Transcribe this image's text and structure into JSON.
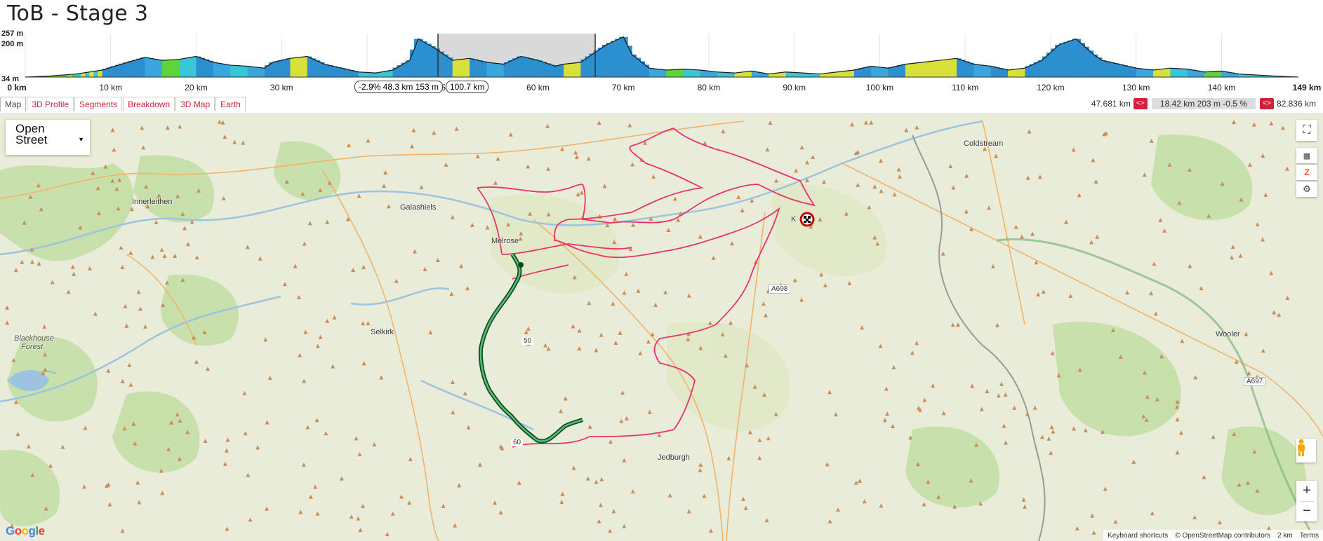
{
  "title": "ToB - Stage 3",
  "profile": {
    "y_labels": [
      "257 m",
      "200 m",
      "34 m"
    ],
    "x_labels": [
      "0 km",
      "10 km",
      "20 km",
      "30 km",
      "40 km",
      "50 km",
      "60 km",
      "70 km",
      "80 km",
      "90 km",
      "100 km",
      "110 km",
      "120 km",
      "130 km",
      "140 km",
      "149 km"
    ],
    "selection_info": "-2.9% 48.3 km 153 m",
    "selection_end": "100.7 km",
    "chart_data": {
      "type": "area",
      "x": [
        0,
        3,
        6,
        9,
        12,
        14,
        16,
        18,
        20,
        22,
        24,
        26,
        28,
        29,
        31,
        33,
        35,
        37,
        39,
        41,
        43,
        45,
        46,
        48,
        50,
        52,
        54,
        56,
        58,
        60,
        62,
        63,
        65,
        66,
        68,
        70,
        71,
        73,
        75,
        77,
        79,
        81,
        83,
        85,
        87,
        89,
        91,
        93,
        95,
        97,
        99,
        101,
        103,
        105,
        107,
        109,
        111,
        113,
        115,
        117,
        119,
        121,
        123,
        125,
        126,
        127,
        128,
        130,
        132,
        134,
        136,
        138,
        140,
        142,
        144,
        146,
        149
      ],
      "y": [
        34,
        40,
        50,
        70,
        110,
        135,
        120,
        125,
        140,
        110,
        95,
        90,
        80,
        110,
        130,
        140,
        100,
        80,
        60,
        55,
        70,
        120,
        230,
        180,
        120,
        130,
        110,
        100,
        140,
        120,
        90,
        100,
        110,
        140,
        200,
        240,
        150,
        80,
        70,
        75,
        70,
        60,
        55,
        65,
        50,
        60,
        55,
        50,
        60,
        70,
        90,
        80,
        100,
        110,
        120,
        130,
        100,
        90,
        70,
        80,
        120,
        200,
        230,
        150,
        120,
        110,
        100,
        80,
        70,
        80,
        75,
        60,
        65,
        50,
        45,
        40,
        34
      ],
      "xlim": [
        0,
        149
      ],
      "ylim": [
        34,
        257
      ],
      "selection": [
        48.3,
        66.7
      ]
    }
  },
  "tabs": [
    "Map",
    "3D Profile",
    "Segments",
    "Breakdown",
    "3D Map",
    "Earth"
  ],
  "stats": {
    "left": "47.681 km",
    "mid": "18.42 km 203 m -0.5 %",
    "right": "82.836 km",
    "arrow": "<>"
  },
  "map": {
    "layer_label_1": "Open",
    "layer_label_2": "Street",
    "places": [
      "Coldstream",
      "Innerleithen",
      "Galashiels",
      "Melrose",
      "Selkirk",
      "Blackhouse",
      "Forest",
      "Jedburgh",
      "Wooler",
      "K"
    ],
    "roads": [
      "A698",
      "A697",
      "50",
      "60"
    ],
    "attribution": [
      "Keyboard shortcuts",
      "© OpenStreetMap contributors",
      "2 km",
      "Terms"
    ],
    "google": "Google"
  }
}
